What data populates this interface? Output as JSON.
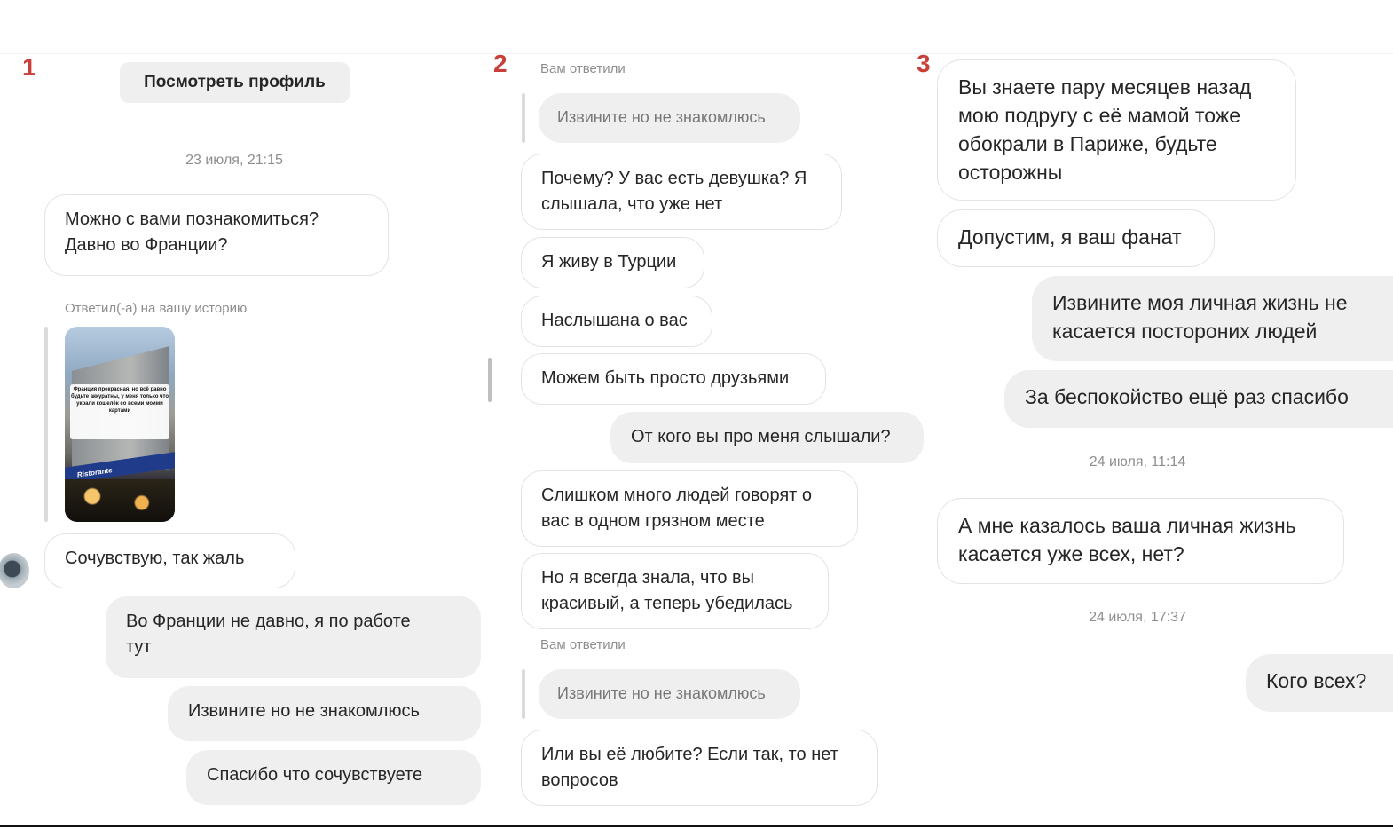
{
  "labels": {
    "p1": "1",
    "p2": "2",
    "p3": "3"
  },
  "panel1": {
    "profile_button": "Посмотреть профиль",
    "timestamp": "23 июля, 21:15",
    "msg1": "Можно с вами познакомиться?\nДавно во Франции?",
    "story_reply_label": "Ответил(-а) на вашу историю",
    "story_text": "Франция прекрасная, но всё равно будьте аккуратны, у меня только что украли кошелёк со всеми моими картами",
    "story_sign": "Ristorante",
    "msg2": "Сочувствую, так жаль",
    "out1": "Во Франции не давно, я по работе\nтут",
    "out2": "Извините но не знакомлюсь",
    "out3": "Спасибо что сочувствуете"
  },
  "panel2": {
    "replied_label_1": "Вам ответили",
    "quote_1": "Извините но не знакомлюсь",
    "msg1": "Почему? У вас есть девушка? Я\nслышала, что уже нет",
    "msg2": "Я живу в Турции",
    "msg3": "Наслышана о вас",
    "msg4": "Можем быть просто друзьями",
    "out1": "От кого вы про меня слышали?",
    "msg5": "Слишком много людей говорят о\nвас в одном грязном месте",
    "msg6": "Но я всегда знала, что вы\nкрасивый, а теперь убедилась",
    "replied_label_2": "Вам ответили",
    "quote_2": "Извините но не знакомлюсь",
    "msg7": "Или вы её любите? Если так, то нет\nвопросов"
  },
  "panel3": {
    "msg1": "Вы знаете пару месяцев назад\nмою подругу с её мамой тоже\nобокрали в Париже, будьте\nосторожны",
    "msg2": "Допустим, я ваш фанат",
    "out1": "Извините моя личная жизнь не\nкасается посторониx людей",
    "out2": "За беспокойство ещё раз спасибо",
    "timestamp1": "24 июля, 11:14",
    "msg3": "А мне казалось ваша личная жизнь\nкасается уже всех, нет?",
    "timestamp2": "24 июля, 17:37",
    "out3": "Кого всех?"
  },
  "icons": {
    "avatar": "user-avatar",
    "story": "story-thumbnail"
  }
}
